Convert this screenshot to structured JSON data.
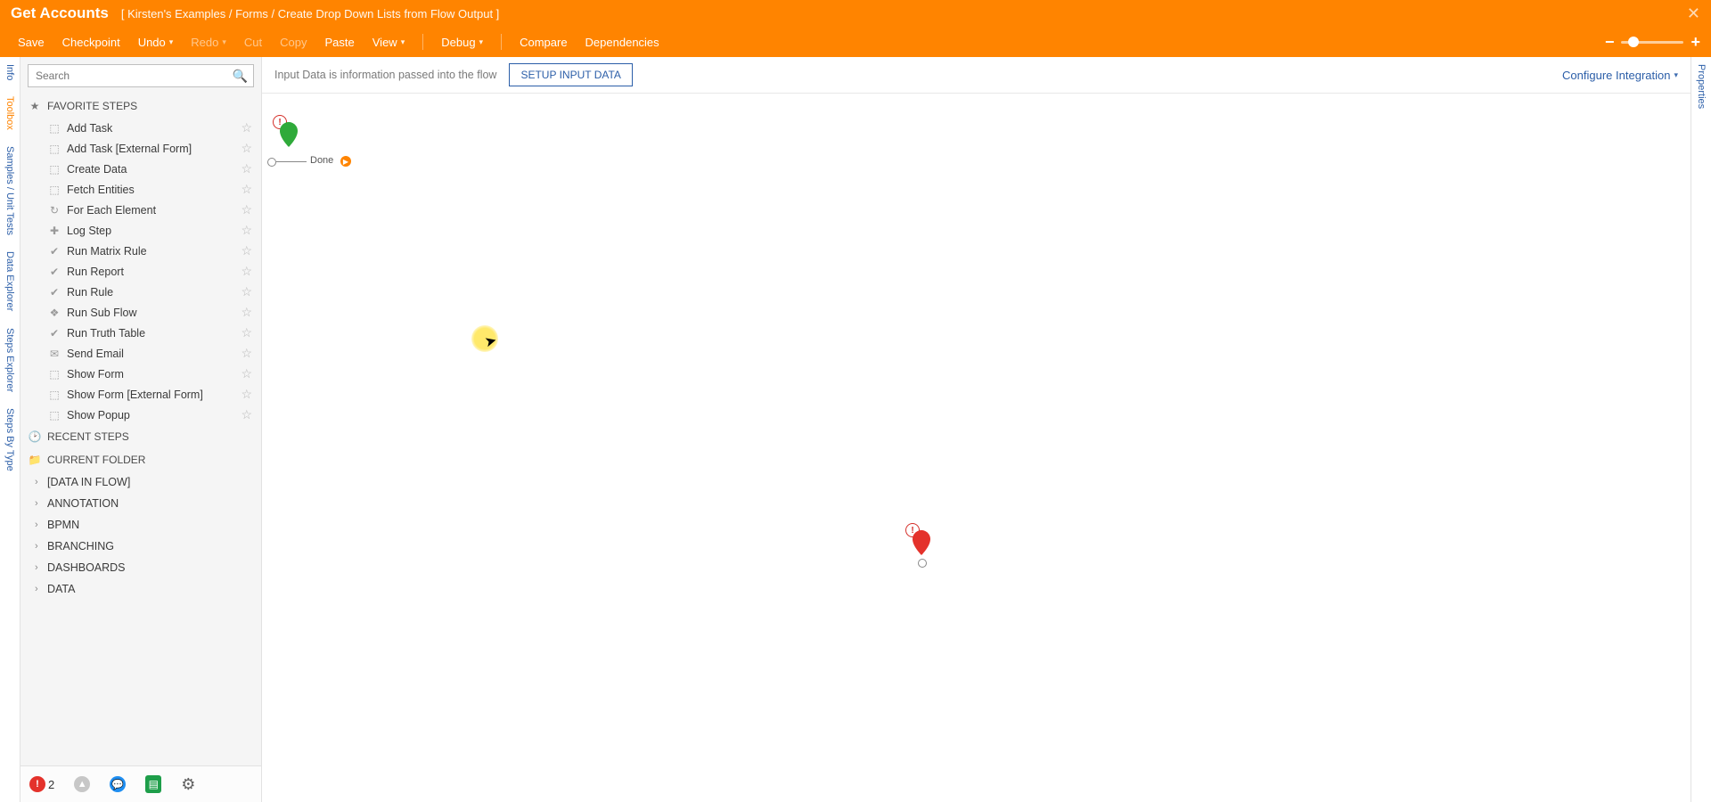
{
  "header": {
    "title": "Get Accounts",
    "breadcrumb": "[ Kirsten's Examples / Forms / Create Drop Down Lists from Flow Output ]",
    "menu": {
      "save": "Save",
      "checkpoint": "Checkpoint",
      "undo": "Undo",
      "redo": "Redo",
      "cut": "Cut",
      "copy": "Copy",
      "paste": "Paste",
      "view": "View",
      "debug": "Debug",
      "compare": "Compare",
      "dependencies": "Dependencies"
    }
  },
  "left_rail": {
    "info": "Info",
    "toolbox": "Toolbox",
    "samples": "Samples / Unit Tests",
    "data_explorer": "Data Explorer",
    "steps_explorer": "Steps Explorer",
    "steps_by_type": "Steps By Type"
  },
  "right_rail": {
    "properties": "Properties"
  },
  "sidebar": {
    "search_placeholder": "Search",
    "favorites_h": "FAVORITE STEPS",
    "recent_h": "RECENT STEPS",
    "current_h": "CURRENT FOLDER",
    "steps": [
      "Add Task",
      "Add Task [External Form]",
      "Create Data",
      "Fetch Entities",
      "For Each Element",
      "Log Step",
      "Run Matrix Rule",
      "Run Report",
      "Run Rule",
      "Run Sub Flow",
      "Run Truth Table",
      "Send Email",
      "Show Form",
      "Show Form [External Form]",
      "Show Popup"
    ],
    "folders": [
      "[DATA IN FLOW]",
      "ANNOTATION",
      "BPMN",
      "BRANCHING",
      "DASHBOARDS",
      "DATA"
    ],
    "footer": {
      "err_count": "2"
    }
  },
  "canvas": {
    "hint": "Input Data is information passed into the flow",
    "setup_btn": "SETUP INPUT DATA",
    "configure": "Configure Integration",
    "done_label": "Done"
  }
}
